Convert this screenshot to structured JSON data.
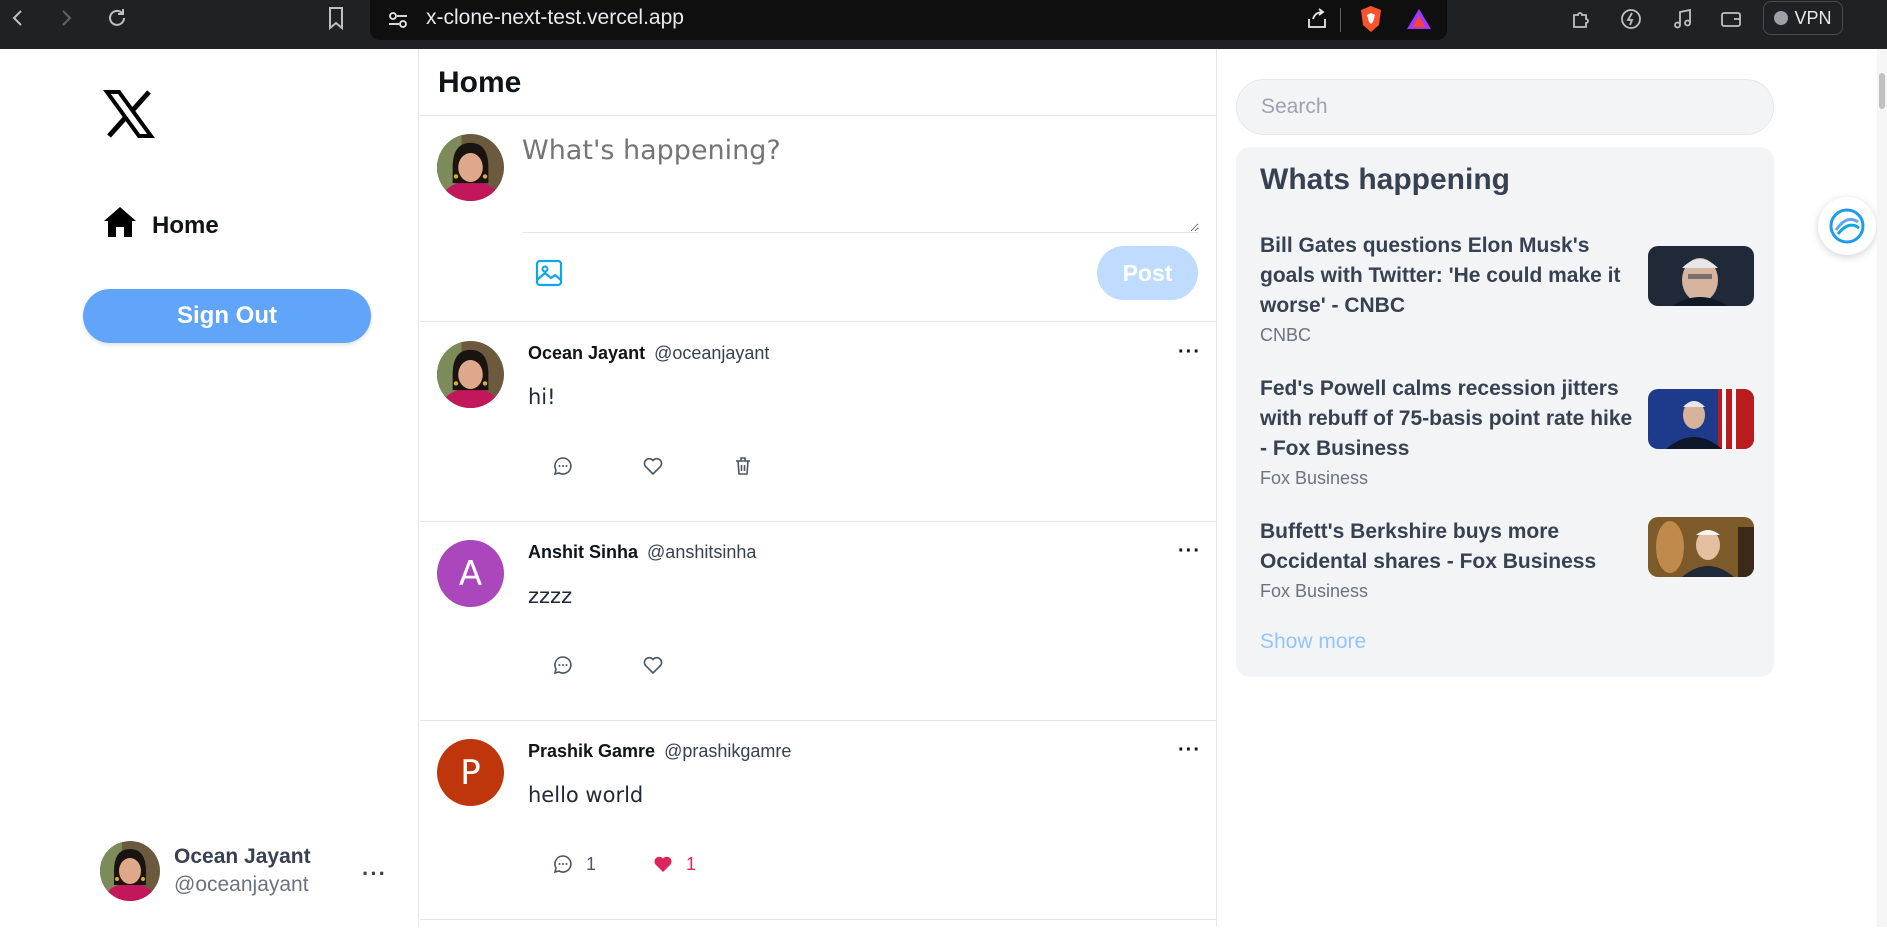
{
  "browser": {
    "url": "x-clone-next-test.vercel.app",
    "vpn_label": "VPN",
    "icons": [
      "back-icon",
      "forward-icon",
      "reload-icon",
      "bookmark-icon",
      "site-settings-icon",
      "share-icon",
      "brave-shield-icon",
      "brave-rewards-icon",
      "extensions-icon",
      "leo-icon",
      "media-icon",
      "wallet-icon"
    ]
  },
  "sidebar": {
    "logo": "x-logo-icon",
    "nav": [
      {
        "label": "Home",
        "icon": "home-icon"
      }
    ],
    "sign_out_label": "Sign Out",
    "user": {
      "name": "Ocean Jayant",
      "handle": "@oceanjayant",
      "more": "···"
    }
  },
  "feed": {
    "title": "Home",
    "composer": {
      "placeholder": "What's happening?",
      "post_label": "Post",
      "image_icon": "image-icon"
    },
    "tweets": [
      {
        "name": "Ocean Jayant",
        "handle": "@oceanjayant",
        "text": "hi!",
        "avatar": "photo",
        "more": "···",
        "comments": "",
        "likes": "",
        "can_delete": true,
        "liked": false
      },
      {
        "name": "Anshit Sinha",
        "handle": "@anshitsinha",
        "text": "zzzz",
        "avatar_letter": "A",
        "avatar_color": "#ab47bc",
        "more": "···",
        "comments": "",
        "likes": "",
        "can_delete": false,
        "liked": false
      },
      {
        "name": "Prashik Gamre",
        "handle": "@prashikgamre",
        "text": "hello world",
        "avatar_letter": "P",
        "avatar_color": "#bf360c",
        "more": "···",
        "comments": "1",
        "likes": "1",
        "can_delete": false,
        "liked": true
      }
    ]
  },
  "right": {
    "search_placeholder": "Search",
    "trends_title": "Whats happening",
    "news": [
      {
        "title": "Bill Gates questions Elon Musk's goals with Twitter: 'He could make it worse' - CNBC",
        "source": "CNBC"
      },
      {
        "title": "Fed's Powell calms recession jitters with rebuff of 75-basis point rate hike - Fox Business",
        "source": "Fox Business"
      },
      {
        "title": "Buffett's Berkshire buys more Occidental shares - Fox Business",
        "source": "Fox Business"
      }
    ],
    "show_more": "Show more"
  },
  "colors": {
    "accent": "#60a5fa",
    "post_disabled": "#bfdbfe",
    "like_active": "#e0245e"
  }
}
